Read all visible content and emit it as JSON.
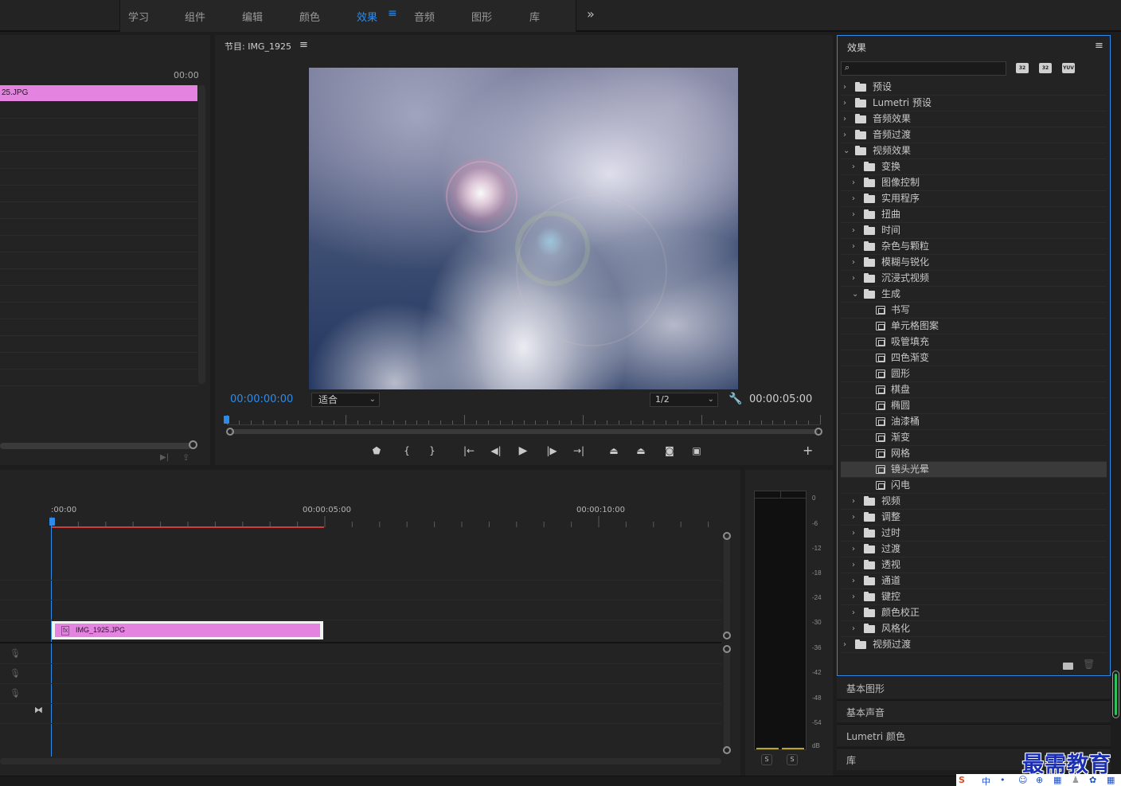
{
  "workspace": {
    "tabs": [
      "学习",
      "组件",
      "编辑",
      "颜色",
      "效果",
      "音频",
      "图形",
      "库"
    ],
    "active_tab": "效果",
    "menu_icon": "hamburger-icon",
    "more_icon": "chevron-double-right-icon",
    "more_glyph": "»"
  },
  "source_panel": {
    "timecode": "00:00",
    "clip_name": "25.JPG"
  },
  "program": {
    "title": "节目: IMG_1925",
    "menu_glyph": "≡",
    "current_time": "00:00:00:00",
    "fit": "适合",
    "resolution": "1/2",
    "duration": "00:00:05:00",
    "add_glyph": "+",
    "transport": [
      {
        "name": "add-marker-button",
        "glyph": "⬟"
      },
      {
        "name": "mark-in-button",
        "glyph": "{"
      },
      {
        "name": "mark-out-button",
        "glyph": "}"
      },
      {
        "name": "go-to-in-button",
        "glyph": "|←"
      },
      {
        "name": "step-back-button",
        "glyph": "◀|"
      },
      {
        "name": "play-button",
        "glyph": "▶"
      },
      {
        "name": "step-forward-button",
        "glyph": "|▶"
      },
      {
        "name": "go-to-out-button",
        "glyph": "→|"
      },
      {
        "name": "lift-button",
        "glyph": "⏏"
      },
      {
        "name": "extract-button",
        "glyph": "⏏"
      },
      {
        "name": "export-frame-button",
        "glyph": "◙"
      },
      {
        "name": "comparison-view-button",
        "glyph": "▣"
      }
    ]
  },
  "timeline": {
    "timecodes": [
      ":00:00",
      "00:00:05:00",
      "00:00:10:00"
    ],
    "clip_name": "IMG_1925.JPG",
    "clip_fx": "fx",
    "mic_glyph": "🎙",
    "snap_glyph": "⧓"
  },
  "meter": {
    "db_labels": [
      "0",
      "-6",
      "-12",
      "-18",
      "-24",
      "-30",
      "-36",
      "-42",
      "-48",
      "-54",
      "dB"
    ],
    "solo_labels": [
      "S",
      "S"
    ]
  },
  "effects": {
    "title": "效果",
    "menu_glyph": "≡",
    "search_placeholder": "",
    "search_glyph": "⌕",
    "badges": [
      "32",
      "32",
      "YUV"
    ],
    "tree": [
      {
        "label": "预设",
        "depth": 0,
        "expanded": false,
        "kind": "preset"
      },
      {
        "label": "Lumetri 预设",
        "depth": 0,
        "expanded": false,
        "kind": "preset"
      },
      {
        "label": "音频效果",
        "depth": 0,
        "expanded": false,
        "kind": "folder"
      },
      {
        "label": "音频过渡",
        "depth": 0,
        "expanded": false,
        "kind": "folder"
      },
      {
        "label": "视频效果",
        "depth": 0,
        "expanded": true,
        "kind": "folder"
      },
      {
        "label": "变换",
        "depth": 1,
        "expanded": false,
        "kind": "folder"
      },
      {
        "label": "图像控制",
        "depth": 1,
        "expanded": false,
        "kind": "folder"
      },
      {
        "label": "实用程序",
        "depth": 1,
        "expanded": false,
        "kind": "folder"
      },
      {
        "label": "扭曲",
        "depth": 1,
        "expanded": false,
        "kind": "folder"
      },
      {
        "label": "时间",
        "depth": 1,
        "expanded": false,
        "kind": "folder"
      },
      {
        "label": "杂色与颗粒",
        "depth": 1,
        "expanded": false,
        "kind": "folder"
      },
      {
        "label": "模糊与锐化",
        "depth": 1,
        "expanded": false,
        "kind": "folder"
      },
      {
        "label": "沉浸式视频",
        "depth": 1,
        "expanded": false,
        "kind": "folder"
      },
      {
        "label": "生成",
        "depth": 1,
        "expanded": true,
        "kind": "folder"
      },
      {
        "label": "书写",
        "depth": 2,
        "kind": "effect"
      },
      {
        "label": "单元格图案",
        "depth": 2,
        "kind": "effect"
      },
      {
        "label": "吸管填充",
        "depth": 2,
        "kind": "effect"
      },
      {
        "label": "四色渐变",
        "depth": 2,
        "kind": "effect"
      },
      {
        "label": "圆形",
        "depth": 2,
        "kind": "effect"
      },
      {
        "label": "棋盘",
        "depth": 2,
        "kind": "effect"
      },
      {
        "label": "椭圆",
        "depth": 2,
        "kind": "effect"
      },
      {
        "label": "油漆桶",
        "depth": 2,
        "kind": "effect"
      },
      {
        "label": "渐变",
        "depth": 2,
        "kind": "effect"
      },
      {
        "label": "网格",
        "depth": 2,
        "kind": "effect"
      },
      {
        "label": "镜头光晕",
        "depth": 2,
        "kind": "effect",
        "selected": true
      },
      {
        "label": "闪电",
        "depth": 2,
        "kind": "effect"
      },
      {
        "label": "视频",
        "depth": 1,
        "expanded": false,
        "kind": "folder"
      },
      {
        "label": "调整",
        "depth": 1,
        "expanded": false,
        "kind": "folder"
      },
      {
        "label": "过时",
        "depth": 1,
        "expanded": false,
        "kind": "folder"
      },
      {
        "label": "过渡",
        "depth": 1,
        "expanded": false,
        "kind": "folder"
      },
      {
        "label": "透视",
        "depth": 1,
        "expanded": false,
        "kind": "folder"
      },
      {
        "label": "通道",
        "depth": 1,
        "expanded": false,
        "kind": "folder"
      },
      {
        "label": "键控",
        "depth": 1,
        "expanded": false,
        "kind": "folder"
      },
      {
        "label": "颜色校正",
        "depth": 1,
        "expanded": false,
        "kind": "folder"
      },
      {
        "label": "风格化",
        "depth": 1,
        "expanded": false,
        "kind": "folder"
      },
      {
        "label": "视频过渡",
        "depth": 0,
        "expanded": false,
        "kind": "folder"
      }
    ],
    "trash_glyph": "🗑"
  },
  "stacked_panels": [
    "基本图形",
    "基本声音",
    "Lumetri 颜色",
    "库"
  ],
  "watermark": "最需教育",
  "tray": {
    "ime_glyph": "S",
    "items": [
      "中",
      "•",
      "☺",
      "⊕",
      "▦",
      "♟",
      "✿",
      "▦"
    ]
  },
  "colors": {
    "accent": "#2d8ceb",
    "clip": "#e584e0",
    "work_area": "#d23b3b",
    "meter_green": "#2fc25a"
  }
}
